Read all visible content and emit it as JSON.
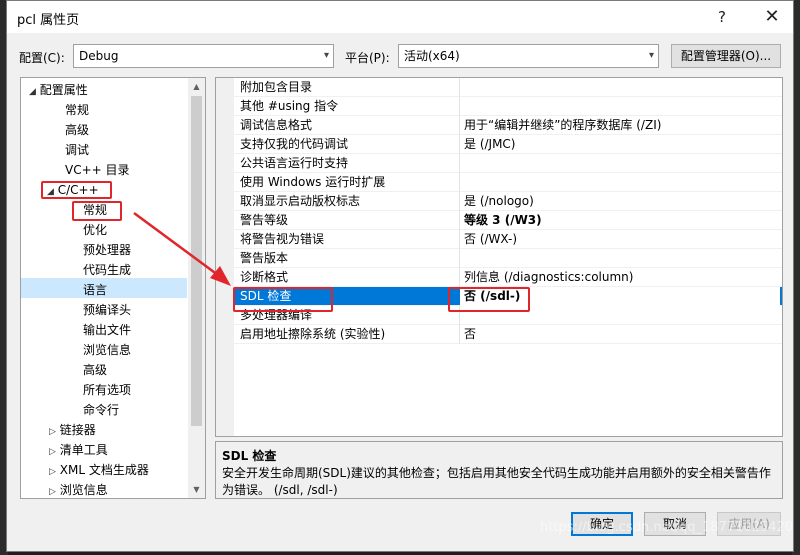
{
  "window": {
    "title": "pcl 属性页",
    "help_glyph": "?",
    "close_glyph": "✕"
  },
  "toolbar": {
    "config_label": "配置(C):",
    "config_value": "Debug",
    "platform_label": "平台(P):",
    "platform_value": "活动(x64)",
    "config_manager_label": "配置管理器(O)..."
  },
  "tree": {
    "items": [
      {
        "label": "配置属性",
        "caret": "◢"
      },
      {
        "label": "常规"
      },
      {
        "label": "高级"
      },
      {
        "label": "调试"
      },
      {
        "label": "VC++ 目录"
      },
      {
        "label": "C/C++",
        "caret": "◢"
      },
      {
        "label": "常规"
      },
      {
        "label": "优化"
      },
      {
        "label": "预处理器"
      },
      {
        "label": "代码生成"
      },
      {
        "label": "语言"
      },
      {
        "label": "预编译头"
      },
      {
        "label": "输出文件"
      },
      {
        "label": "浏览信息"
      },
      {
        "label": "高级"
      },
      {
        "label": "所有选项"
      },
      {
        "label": "命令行"
      },
      {
        "label": "链接器",
        "caret": "▷"
      },
      {
        "label": "清单工具",
        "caret": "▷"
      },
      {
        "label": "XML 文档生成器",
        "caret": "▷"
      },
      {
        "label": "浏览信息",
        "caret": "▷"
      }
    ]
  },
  "properties": [
    {
      "name": "附加包含目录",
      "value": ""
    },
    {
      "name": "其他 #using 指令",
      "value": ""
    },
    {
      "name": "调试信息格式",
      "value": "用于“编辑并继续”的程序数据库 (/ZI)"
    },
    {
      "name": "支持仅我的代码调试",
      "value": "是 (/JMC)"
    },
    {
      "name": "公共语言运行时支持",
      "value": ""
    },
    {
      "name": "使用 Windows 运行时扩展",
      "value": ""
    },
    {
      "name": "取消显示启动版权标志",
      "value": "是 (/nologo)"
    },
    {
      "name": "警告等级",
      "value": "等级 3 (/W3)"
    },
    {
      "name": "将警告视为错误",
      "value": "否 (/WX-)"
    },
    {
      "name": "警告版本",
      "value": ""
    },
    {
      "name": "诊断格式",
      "value": "列信息 (/diagnostics:column)"
    },
    {
      "name": "SDL 检查",
      "value": "否 (/sdl-)"
    },
    {
      "name": "多处理器编译",
      "value": ""
    },
    {
      "name": "启用地址擦除系统 (实验性)",
      "value": "否"
    }
  ],
  "description": {
    "title": "SDL 检查",
    "text": "安全开发生命周期(SDL)建议的其他检查；包括启用其他安全代码生成功能并启用额外的安全相关警告作为错误。    (/sdl, /sdl-)"
  },
  "buttons": {
    "ok": "确定",
    "cancel": "取消",
    "apply": "应用(A)"
  },
  "watermark": "https://blog.csdn.net/qq_18771025420",
  "colors": {
    "selection": "#0078d7",
    "annotation": "#e0252b"
  }
}
